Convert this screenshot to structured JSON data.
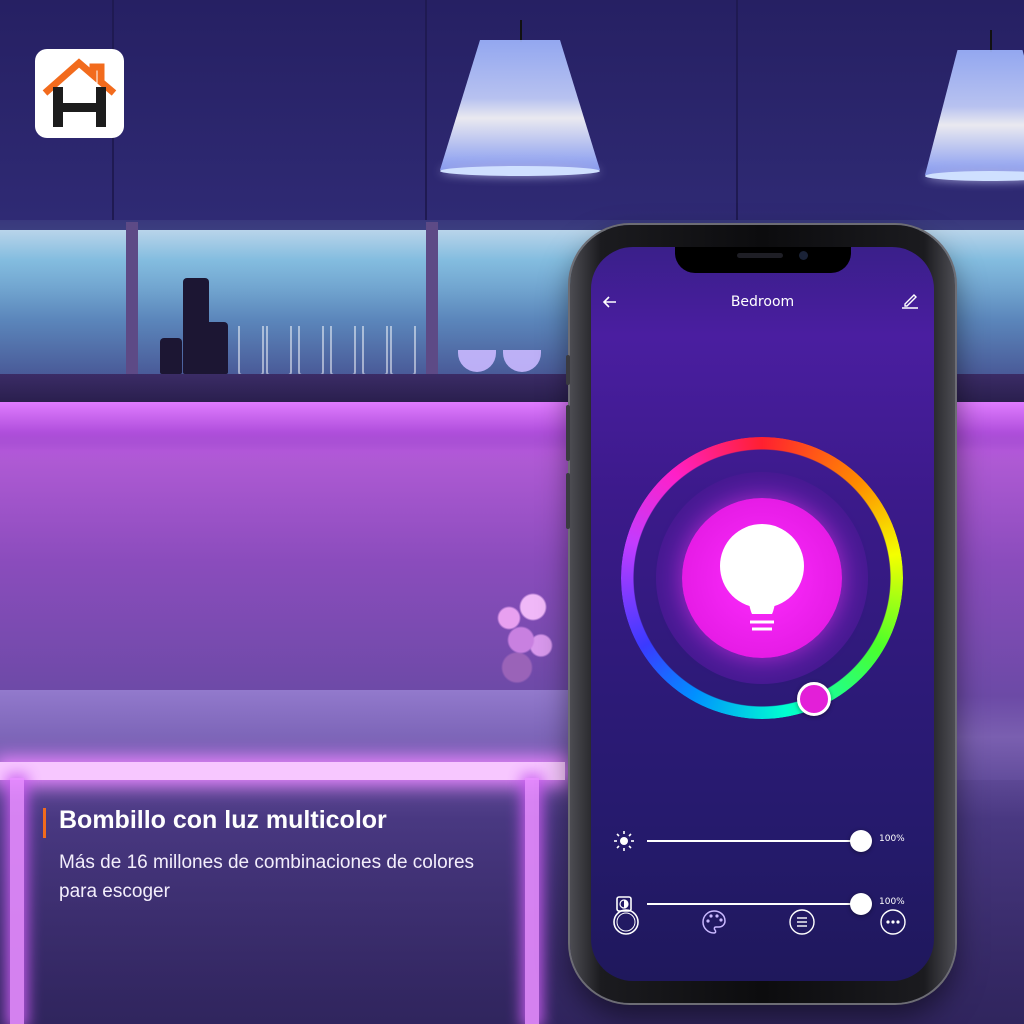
{
  "caption": {
    "title": "Bombillo con luz multicolor",
    "subtitle": "Más de 16 millones de combinaciones de colores para escoger"
  },
  "app": {
    "screen_title": "Bedroom",
    "selected_color": "#e61ce6",
    "brightness": {
      "value_label": "100%",
      "level": 1.0
    },
    "color_temperature": {
      "value_label": "100%",
      "level": 1.0
    },
    "icons": {
      "back": "arrow-left-icon",
      "edit": "edit-icon",
      "bulb": "light-bulb-icon",
      "brightness": "sun-icon",
      "contrast": "contrast-icon",
      "nav": [
        "power-ring-icon",
        "palette-icon",
        "list-icon",
        "more-icon"
      ]
    }
  },
  "colors": {
    "accent": "#f26b1d",
    "bulb_glow": "#ff2bff"
  }
}
